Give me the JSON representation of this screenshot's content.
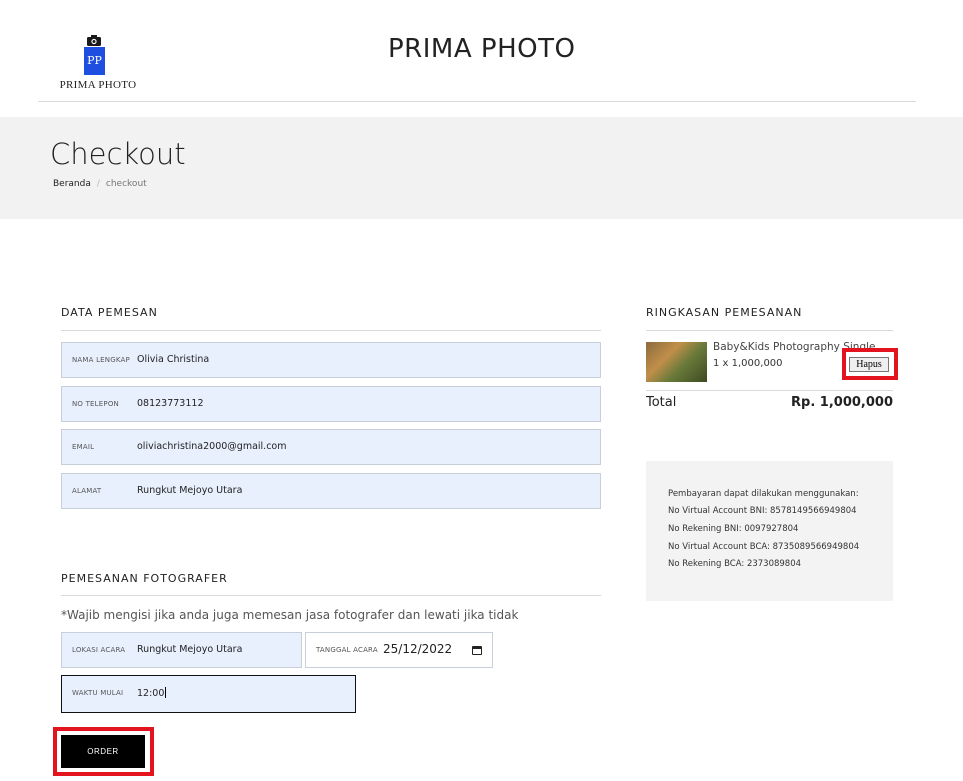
{
  "header": {
    "logo_initials": "PP",
    "logo_text": "PRIMA PHOTO",
    "site_title": "PRIMA PHOTO"
  },
  "hero": {
    "title": "Checkout",
    "breadcrumb": {
      "home": "Beranda",
      "separator": "/",
      "current": "checkout"
    }
  },
  "data_pemesan": {
    "title": "DATA PEMESAN",
    "fields": [
      {
        "label": "NAMA LENGKAP",
        "value": "Olivia Christina"
      },
      {
        "label": "NO TELEPON",
        "value": "08123773112"
      },
      {
        "label": "EMAIL",
        "value": "oliviachristina2000@gmail.com"
      },
      {
        "label": "ALAMAT",
        "value": "Rungkut Mejoyo Utara"
      }
    ]
  },
  "pemesanan_fotografer": {
    "title": "PEMESANAN FOTOGRAFER",
    "note": "*Wajib mengisi jika anda juga memesan jasa fotografer dan lewati jika tidak",
    "lokasi": {
      "label": "LOKASI ACARA",
      "value": "Rungkut Mejoyo Utara"
    },
    "tanggal": {
      "label": "TANGGAL ACARA",
      "value": "25/12/2022"
    },
    "waktu": {
      "label": "WAKTU MULAI",
      "value": "12:00"
    }
  },
  "order_button": "ORDER",
  "ringkasan": {
    "title": "RINGKASAN PEMESANAN",
    "item": {
      "name": "Baby&Kids Photography Single",
      "qty": "1 x 1,000,000",
      "remove_label": "Hapus"
    },
    "total_label": "Total",
    "total_value": "Rp. 1,000,000"
  },
  "payment": {
    "lines": [
      "Pembayaran dapat dilakukan menggunakan:",
      "No Virtual Account BNI: 8578149566949804",
      "No Rekening BNI: 0097927804",
      "No Virtual Account BCA: 8735089566949804",
      "No Rekening BCA: 2373089804"
    ]
  },
  "colors": {
    "accent": "#000000",
    "highlight": "#e3141f",
    "logo_blue": "#1f4fe0",
    "input_fill": "#e8f0fe"
  }
}
